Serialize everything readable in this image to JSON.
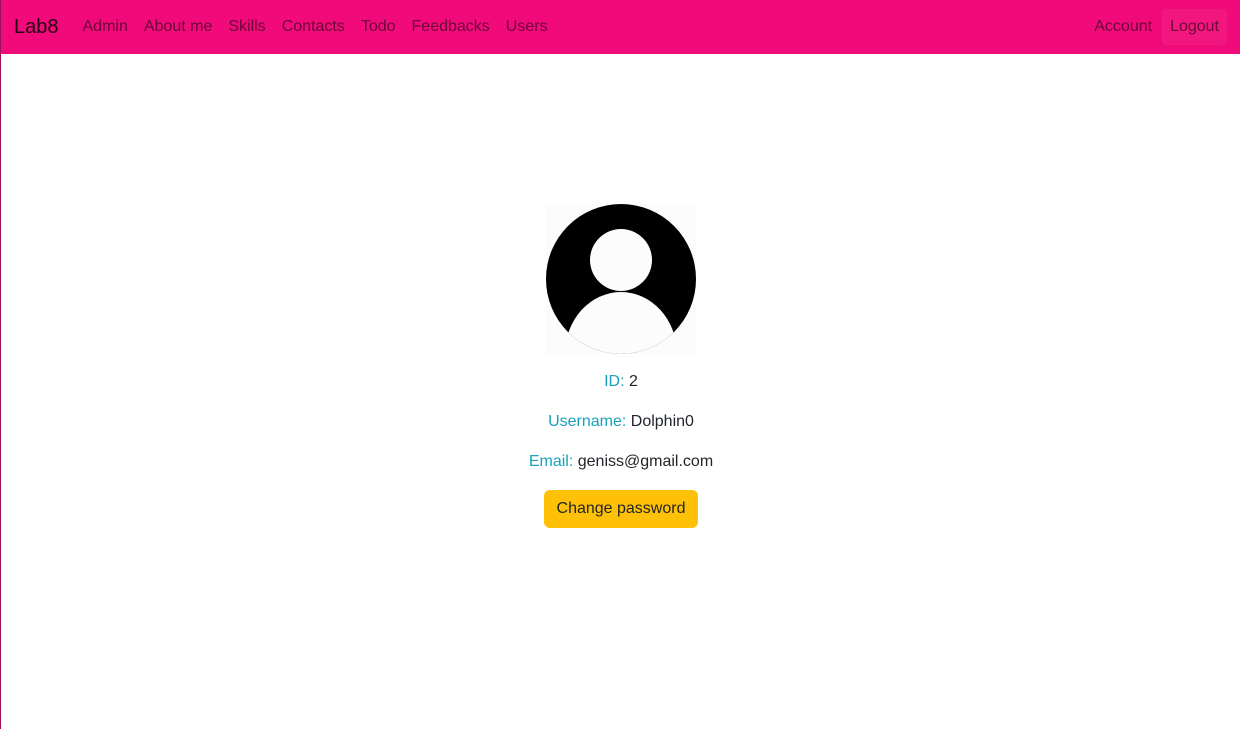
{
  "colors": {
    "navbar_bg": "#f00a7a",
    "logout_bg": "#f2167f",
    "label_color": "#17a2b8",
    "button_bg": "#ffc107"
  },
  "navbar": {
    "brand": "Lab8",
    "links": [
      "Admin",
      "About me",
      "Skills",
      "Contacts",
      "Todo",
      "Feedbacks",
      "Users"
    ],
    "right_links": [
      "Account",
      "Logout"
    ]
  },
  "profile": {
    "avatar_icon": "user-avatar-icon",
    "id_label": "ID:",
    "id_value": "2",
    "username_label": "Username:",
    "username_value": "Dolphin0",
    "email_label": "Email:",
    "email_value": "geniss@gmail.com",
    "change_password_label": "Change password"
  }
}
